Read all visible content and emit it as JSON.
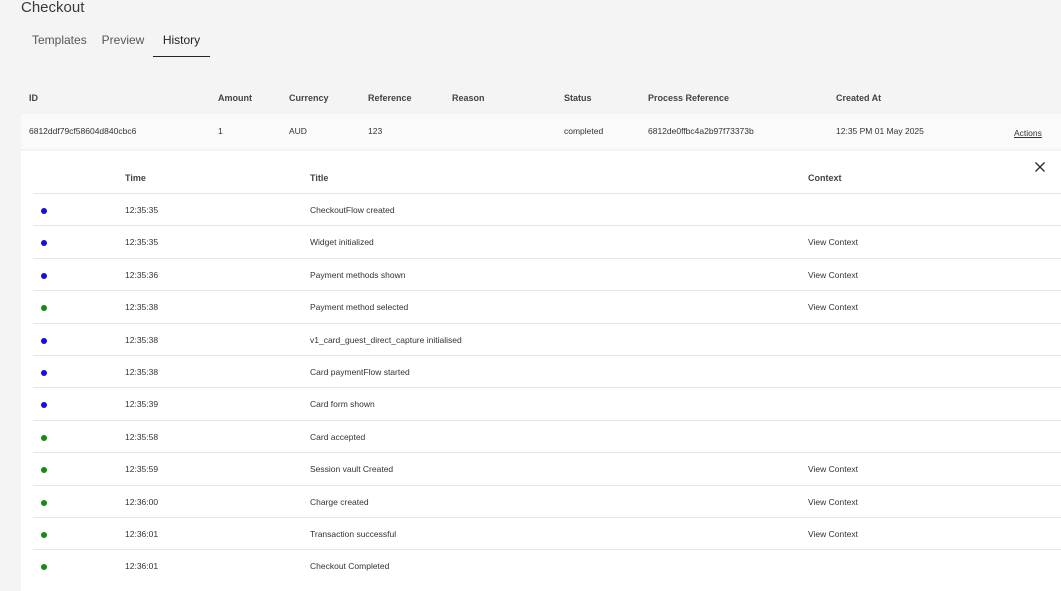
{
  "page": {
    "title": "Checkout"
  },
  "tabs": [
    {
      "label": "Templates",
      "active": false
    },
    {
      "label": "Preview",
      "active": false
    },
    {
      "label": "History",
      "active": true
    }
  ],
  "table": {
    "headers": {
      "id": "ID",
      "amount": "Amount",
      "currency": "Currency",
      "reference": "Reference",
      "reason": "Reason",
      "status": "Status",
      "process_reference": "Process Reference",
      "created_at": "Created At"
    },
    "row": {
      "id": "6812ddf79cf58604d840cbc6",
      "amount": "1",
      "currency": "AUD",
      "reference": "123",
      "reason": "",
      "status": "completed",
      "process_reference": "6812de0ffbc4a2b97f73373b",
      "created_at": "12:35 PM 01 May 2025",
      "actions_label": "Actions"
    }
  },
  "history": {
    "headers": {
      "time": "Time",
      "title": "Title",
      "context": "Context"
    },
    "close_icon": "close-icon",
    "colors": {
      "blue": "#1010e0",
      "green": "#138a13"
    },
    "events": [
      {
        "status": "blue",
        "time": "12:35:35",
        "title": "CheckoutFlow created",
        "context": ""
      },
      {
        "status": "blue",
        "time": "12:35:35",
        "title": "Widget initialized",
        "context": "View Context"
      },
      {
        "status": "blue",
        "time": "12:35:36",
        "title": "Payment methods shown",
        "context": "View Context"
      },
      {
        "status": "green",
        "time": "12:35:38",
        "title": "Payment method selected",
        "context": "View Context"
      },
      {
        "status": "blue",
        "time": "12:35:38",
        "title": "v1_card_guest_direct_capture initialised",
        "context": ""
      },
      {
        "status": "blue",
        "time": "12:35:38",
        "title": "Card paymentFlow started",
        "context": ""
      },
      {
        "status": "blue",
        "time": "12:35:39",
        "title": "Card form shown",
        "context": ""
      },
      {
        "status": "green",
        "time": "12:35:58",
        "title": "Card accepted",
        "context": ""
      },
      {
        "status": "green",
        "time": "12:35:59",
        "title": "Session vault Created",
        "context": "View Context"
      },
      {
        "status": "green",
        "time": "12:36:00",
        "title": "Charge created",
        "context": "View Context"
      },
      {
        "status": "green",
        "time": "12:36:01",
        "title": "Transaction successful",
        "context": "View Context"
      },
      {
        "status": "green",
        "time": "12:36:01",
        "title": "Checkout Completed",
        "context": ""
      }
    ]
  }
}
